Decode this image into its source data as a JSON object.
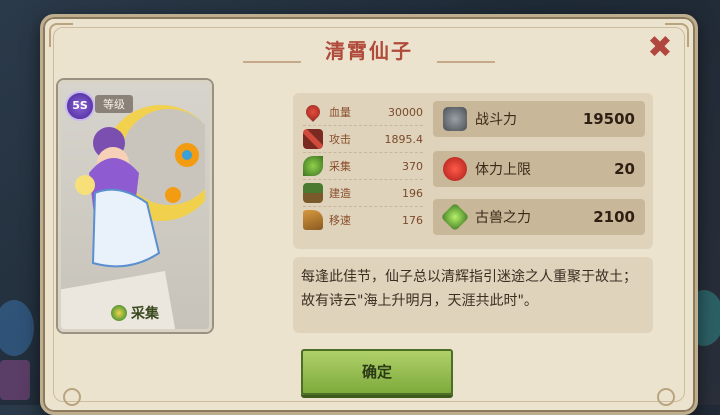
{
  "dialog": {
    "title": "清霄仙子",
    "close_icon": "✖"
  },
  "hero_card": {
    "level_badge": "5S",
    "level_label": "等级",
    "role": "采集",
    "role_icon": "gather-leaf-icon"
  },
  "stats": [
    {
      "label": "血量",
      "value": "30000",
      "icon": "blood-drop-icon",
      "color": "#c0392b"
    },
    {
      "label": "攻击",
      "value": "1895.4",
      "icon": "sword-icon",
      "color": "#b03a2e"
    },
    {
      "label": "采集",
      "value": "370",
      "icon": "gather-leaf-icon",
      "color": "#4d8a2a"
    },
    {
      "label": "建造",
      "value": "196",
      "icon": "build-hammer-icon",
      "color": "#3d6b2a"
    },
    {
      "label": "移速",
      "value": "176",
      "icon": "boot-icon",
      "color": "#b57a30"
    }
  ],
  "big_stats": [
    {
      "label": "战斗力",
      "value": "19500",
      "icon": "fist-icon",
      "color": "#555a60"
    },
    {
      "label": "体力上限",
      "value": "20",
      "icon": "heart-icon",
      "color": "#d8302a"
    },
    {
      "label": "古兽之力",
      "value": "2100",
      "icon": "green-gem-icon",
      "color": "#5aa33a"
    }
  ],
  "description": "每逢此佳节，仙子总以清辉指引迷途之人重聚于故土；故有诗云\"海上升明月，天涯共此时\"。",
  "confirm_label": "确定"
}
